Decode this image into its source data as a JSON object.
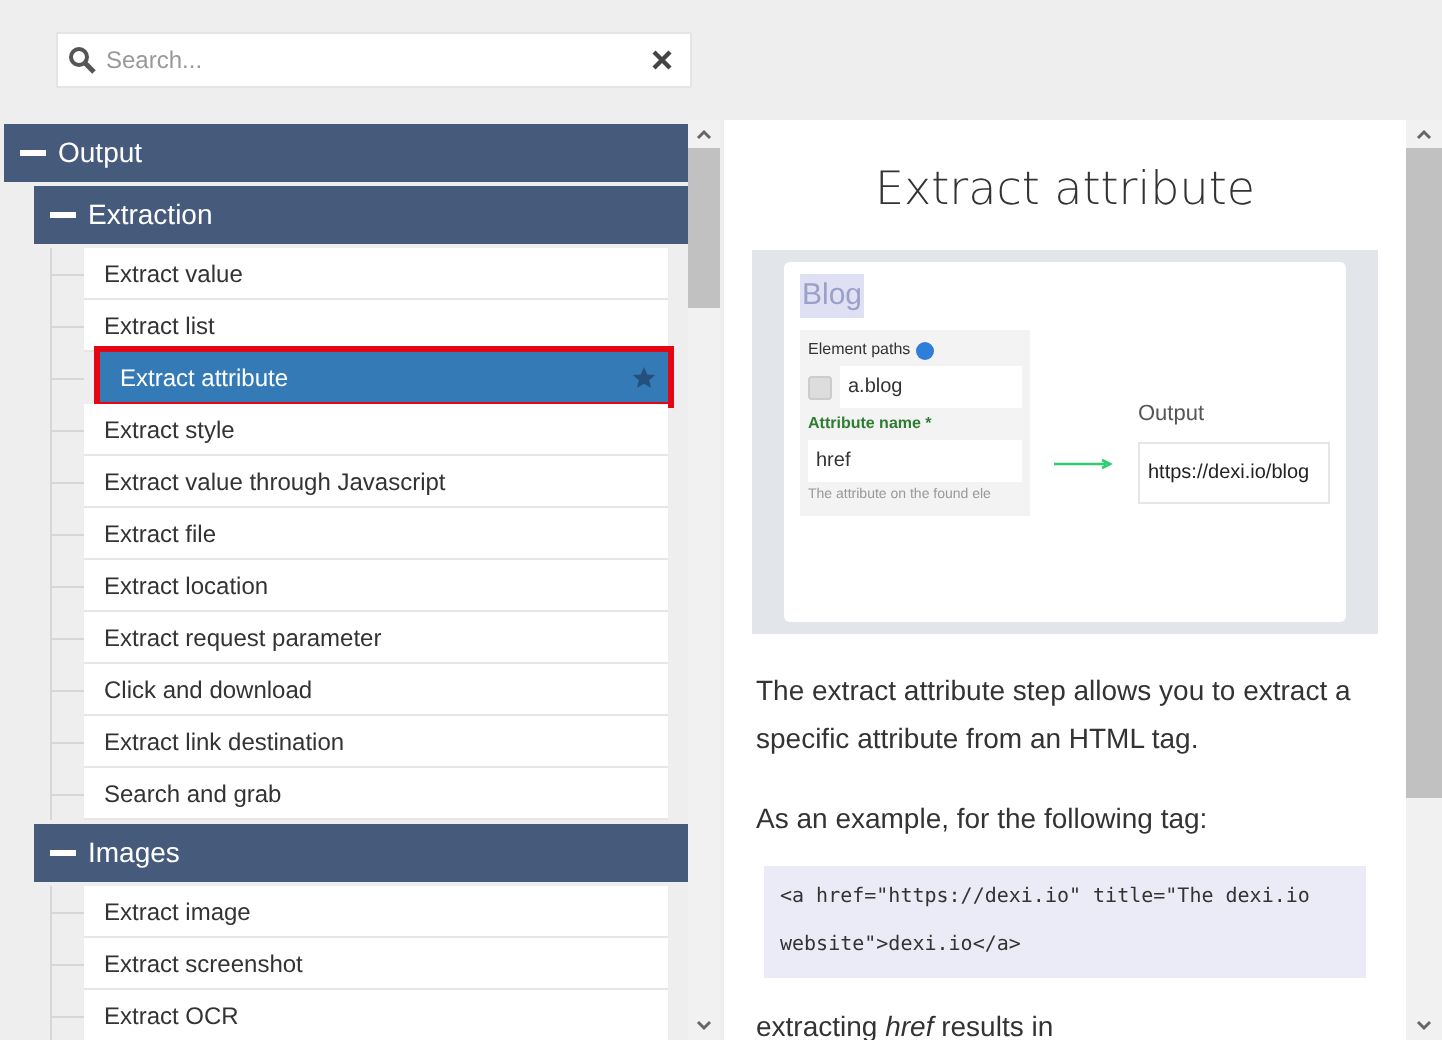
{
  "search": {
    "placeholder": "Search..."
  },
  "tree": [
    {
      "label": "Output",
      "expanded": true,
      "children": [
        {
          "label": "Extraction",
          "expanded": true,
          "children": [
            {
              "label": "Extract value",
              "selected": false,
              "starred": false,
              "highlighted": false
            },
            {
              "label": "Extract list",
              "selected": false,
              "starred": false,
              "highlighted": false
            },
            {
              "label": "Extract attribute",
              "selected": true,
              "starred": true,
              "highlighted": true
            },
            {
              "label": "Extract style",
              "selected": false,
              "starred": false,
              "highlighted": false
            },
            {
              "label": "Extract value through Javascript",
              "selected": false,
              "starred": false,
              "highlighted": false
            },
            {
              "label": "Extract file",
              "selected": false,
              "starred": false,
              "highlighted": false
            },
            {
              "label": "Extract location",
              "selected": false,
              "starred": false,
              "highlighted": false
            },
            {
              "label": "Extract request parameter",
              "selected": false,
              "starred": false,
              "highlighted": false
            },
            {
              "label": "Click and download",
              "selected": false,
              "starred": false,
              "highlighted": false
            },
            {
              "label": "Extract link destination",
              "selected": false,
              "starred": false,
              "highlighted": false
            },
            {
              "label": "Search and grab",
              "selected": false,
              "starred": false,
              "highlighted": false
            }
          ]
        },
        {
          "label": "Images",
          "expanded": true,
          "children": [
            {
              "label": "Extract image",
              "selected": false,
              "starred": false,
              "highlighted": false
            },
            {
              "label": "Extract screenshot",
              "selected": false,
              "starred": false,
              "highlighted": false
            },
            {
              "label": "Extract OCR",
              "selected": false,
              "starred": false,
              "highlighted": false
            }
          ]
        }
      ]
    }
  ],
  "article": {
    "title": "Extract attribute",
    "illustration": {
      "heading": "Blog",
      "field_label": "Element paths",
      "field_value": "a.blog",
      "attribute_label": "Attribute name *",
      "attribute_value": "href",
      "hint": "The attribute on the found ele",
      "output_label": "Output",
      "output_value": "https://dexi.io/blog"
    },
    "blocks": [
      {
        "kind": "text",
        "text": "The extract attribute step allows you to extract a specific attribute from an HTML tag."
      },
      {
        "kind": "text",
        "text": "As an example, for the following tag:"
      },
      {
        "kind": "code",
        "text": "<a href=\"https://dexi.io\" title=\"The dexi.io website\">dexi.io</a>"
      },
      {
        "kind": "text",
        "text": "extracting *href* results in"
      }
    ]
  }
}
